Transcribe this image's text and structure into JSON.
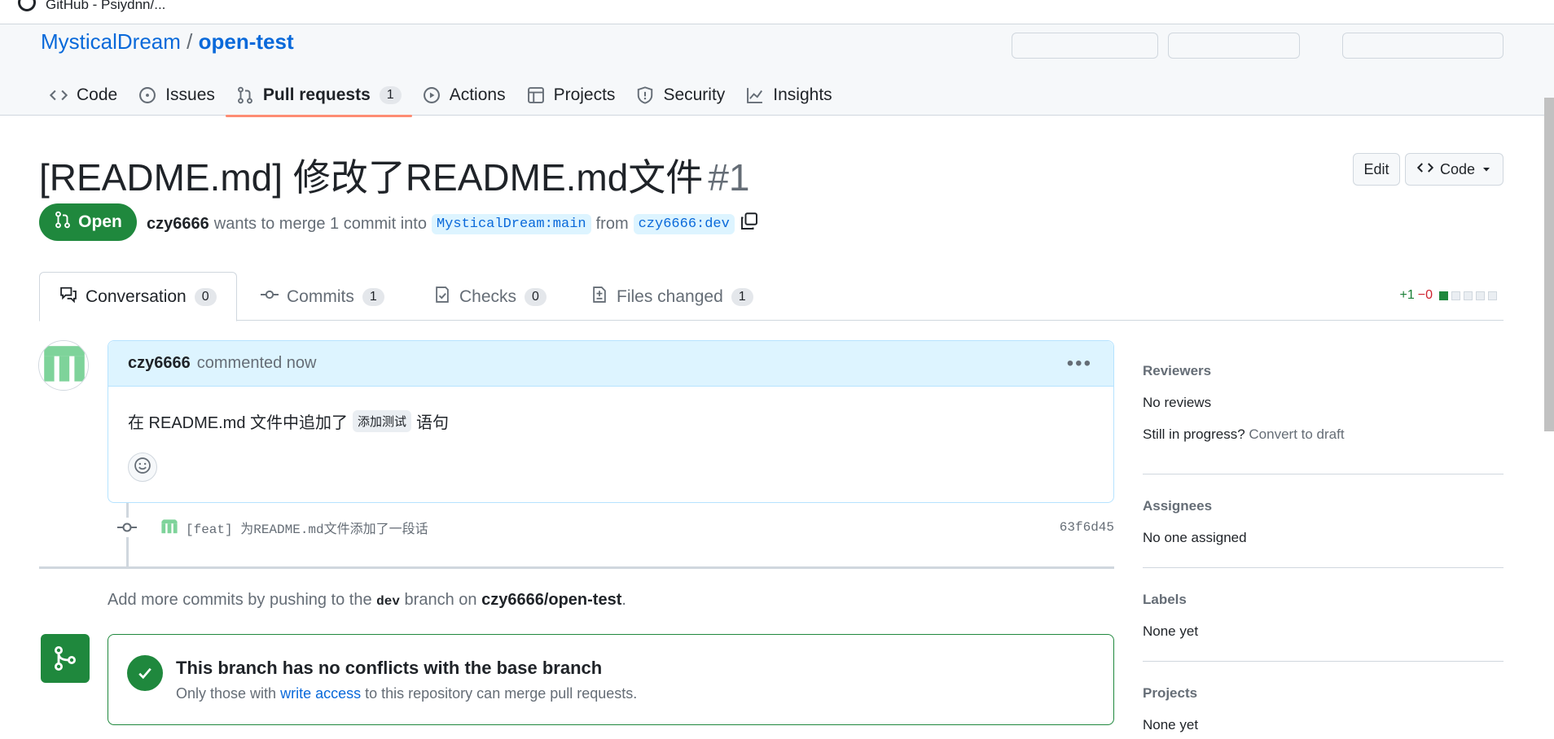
{
  "window": {
    "title": "GitHub - Psiydnn/..."
  },
  "repo": {
    "owner": "MysticalDream",
    "separator": "/",
    "name": "open-test"
  },
  "nav": [
    {
      "label": "Code",
      "icon": "code-icon"
    },
    {
      "label": "Issues",
      "icon": "issue-icon"
    },
    {
      "label": "Pull requests",
      "icon": "pull-request-icon",
      "count": "1"
    },
    {
      "label": "Actions",
      "icon": "play-icon"
    },
    {
      "label": "Projects",
      "icon": "table-icon"
    },
    {
      "label": "Security",
      "icon": "shield-icon"
    },
    {
      "label": "Insights",
      "icon": "graph-icon"
    }
  ],
  "pr": {
    "title": "[README.md] 修改了README.md文件",
    "number": "#1",
    "state": "Open",
    "author": "czy6666",
    "merge_text": "wants to merge 1 commit into",
    "base": "MysticalDream:main",
    "from_text": "from",
    "head": "czy6666:dev",
    "edit_label": "Edit",
    "code_label": "Code"
  },
  "tabs": [
    {
      "label": "Conversation",
      "count": "0"
    },
    {
      "label": "Commits",
      "count": "1"
    },
    {
      "label": "Checks",
      "count": "0"
    },
    {
      "label": "Files changed",
      "count": "1"
    }
  ],
  "diffstat": {
    "added": "+1",
    "removed": "−0"
  },
  "comment": {
    "author": "czy6666",
    "action": "commented now",
    "body_before": "在 README.md 文件中追加了",
    "body_code": "添加测试",
    "body_after": "语句"
  },
  "commit": {
    "message": "[feat] 为README.md文件添加了一段话",
    "sha": "63f6d45"
  },
  "hint": {
    "prefix": "Add more commits by pushing to the",
    "branch": "dev",
    "middle": "branch on",
    "repo": "czy6666/open-test",
    "suffix": "."
  },
  "merge": {
    "title": "This branch has no conflicts with the base branch",
    "sub_prefix": "Only those with",
    "sub_link": "write access",
    "sub_suffix": "to this repository can merge pull requests."
  },
  "sidebar": {
    "reviewers": {
      "heading": "Reviewers",
      "value": "No reviews",
      "progress_q": "Still in progress?",
      "draft_link": "Convert to draft"
    },
    "assignees": {
      "heading": "Assignees",
      "value": "No one assigned"
    },
    "labels": {
      "heading": "Labels",
      "value": "None yet"
    },
    "projects": {
      "heading": "Projects",
      "value": "None yet"
    }
  },
  "colors": {
    "open": "#1f883d",
    "link": "#0969da",
    "underline": "#fd8c73",
    "comment_header": "#ddf4ff"
  }
}
